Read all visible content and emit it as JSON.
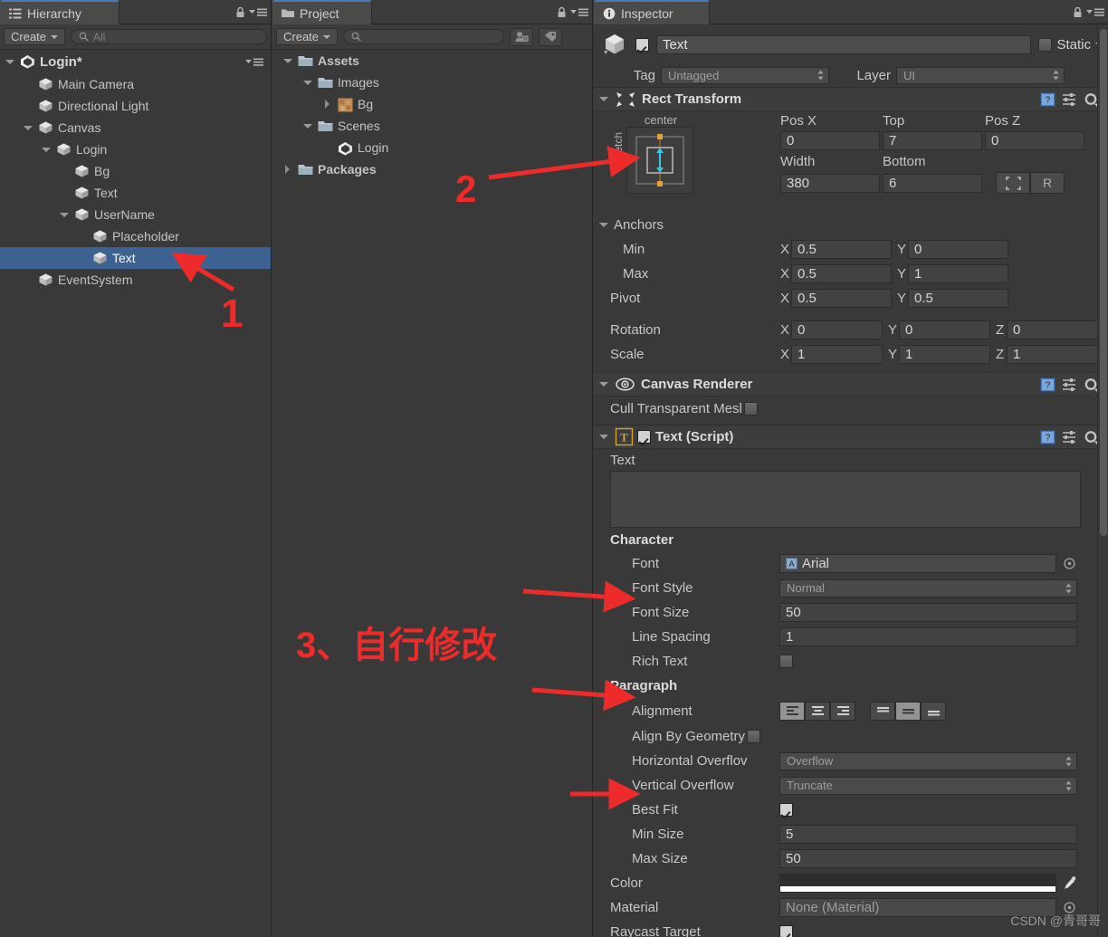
{
  "hierarchy": {
    "tab_label": "Hierarchy",
    "tab_icon": "hierarchy-icon",
    "create_label": "Create",
    "search_placeholder": "All",
    "scene_name": "Login*",
    "items": [
      {
        "label": "Main Camera",
        "depth": 1,
        "twisty": "none"
      },
      {
        "label": "Directional Light",
        "depth": 1,
        "twisty": "none"
      },
      {
        "label": "Canvas",
        "depth": 1,
        "twisty": "down"
      },
      {
        "label": "Login",
        "depth": 2,
        "twisty": "down"
      },
      {
        "label": "Bg",
        "depth": 3,
        "twisty": "none"
      },
      {
        "label": "Text",
        "depth": 3,
        "twisty": "none"
      },
      {
        "label": "UserName",
        "depth": 3,
        "twisty": "down"
      },
      {
        "label": "Placeholder",
        "depth": 4,
        "twisty": "none"
      },
      {
        "label": "Text",
        "depth": 4,
        "twisty": "none",
        "selected": true
      },
      {
        "label": "EventSystem",
        "depth": 1,
        "twisty": "none"
      }
    ]
  },
  "project": {
    "tab_label": "Project",
    "tab_icon": "folder-icon",
    "create_label": "Create",
    "search_placeholder": "",
    "items": [
      {
        "label": "Assets",
        "depth": 0,
        "twisty": "down",
        "icon": "folder-icon",
        "bold": true
      },
      {
        "label": "Images",
        "depth": 1,
        "twisty": "down",
        "icon": "folder-icon",
        "bold": false
      },
      {
        "label": "Bg",
        "depth": 2,
        "twisty": "right",
        "icon": "texture-icon",
        "bold": false
      },
      {
        "label": "Scenes",
        "depth": 1,
        "twisty": "down",
        "icon": "folder-icon",
        "bold": false
      },
      {
        "label": "Login",
        "depth": 2,
        "twisty": "none",
        "icon": "unity-icon",
        "bold": false
      },
      {
        "label": "Packages",
        "depth": 0,
        "twisty": "right",
        "icon": "folder-icon",
        "bold": true
      }
    ]
  },
  "inspector": {
    "tab_label": "Inspector",
    "tab_icon": "info-icon",
    "object_name": "Text",
    "object_enabled": true,
    "static_label": "Static",
    "static_checked": false,
    "tag_label": "Tag",
    "tag_value": "Untagged",
    "layer_label": "Layer",
    "layer_value": "UI",
    "rect_transform": {
      "title": "Rect Transform",
      "anchor_preset_top": "center",
      "anchor_preset_side": "stretch",
      "pos_x_label": "Pos X",
      "pos_x_value": "0",
      "top_label": "Top",
      "top_value": "7",
      "pos_z_label": "Pos Z",
      "pos_z_value": "0",
      "width_label": "Width",
      "width_value": "380",
      "bottom_label": "Bottom",
      "bottom_value": "6",
      "blueprint_button": "blueprint-mode-button",
      "raw_button_label": "R",
      "anchors_label": "Anchors",
      "min_label": "Min",
      "min_x": "0.5",
      "min_y": "0",
      "max_label": "Max",
      "max_x": "0.5",
      "max_y": "1",
      "pivot_label": "Pivot",
      "pivot_x": "0.5",
      "pivot_y": "0.5",
      "rotation_label": "Rotation",
      "rotation_x": "0",
      "rotation_y": "0",
      "rotation_z": "0",
      "scale_label": "Scale",
      "scale_x": "1",
      "scale_y": "1",
      "scale_z": "1"
    },
    "canvas_renderer": {
      "title": "Canvas Renderer",
      "cull_label": "Cull Transparent Mesl",
      "cull_checked": false
    },
    "text_script": {
      "title": "Text (Script)",
      "enabled": true,
      "text_label": "Text",
      "text_value": "",
      "character_label": "Character",
      "font_label": "Font",
      "font_value": "Arial",
      "font_style_label": "Font Style",
      "font_style_value": "Normal",
      "font_size_label": "Font Size",
      "font_size_value": "50",
      "line_spacing_label": "Line Spacing",
      "line_spacing_value": "1",
      "rich_text_label": "Rich Text",
      "rich_text_checked": false,
      "paragraph_label": "Paragraph",
      "alignment_label": "Alignment",
      "alignment_horizontal": "left",
      "alignment_vertical": "middle",
      "align_by_geometry_label": "Align By Geometry",
      "align_by_geometry_checked": false,
      "horizontal_overflow_label": "Horizontal Overflov",
      "horizontal_overflow_value": "Overflow",
      "vertical_overflow_label": "Vertical Overflow",
      "vertical_overflow_value": "Truncate",
      "best_fit_label": "Best Fit",
      "best_fit_checked": true,
      "min_size_label": "Min Size",
      "min_size_value": "5",
      "max_size_label": "Max Size",
      "max_size_value": "50",
      "color_label": "Color",
      "color_value": "#FFFFFF",
      "material_label": "Material",
      "material_value": "None (Material)",
      "raycast_target_label": "Raycast Target",
      "raycast_target_checked": true
    }
  },
  "annotations": {
    "marker_1": "1",
    "marker_2": "2",
    "marker_3": "3、自行修改",
    "color": "#ee2b2b"
  },
  "watermark": "CSDN @青哥哥"
}
